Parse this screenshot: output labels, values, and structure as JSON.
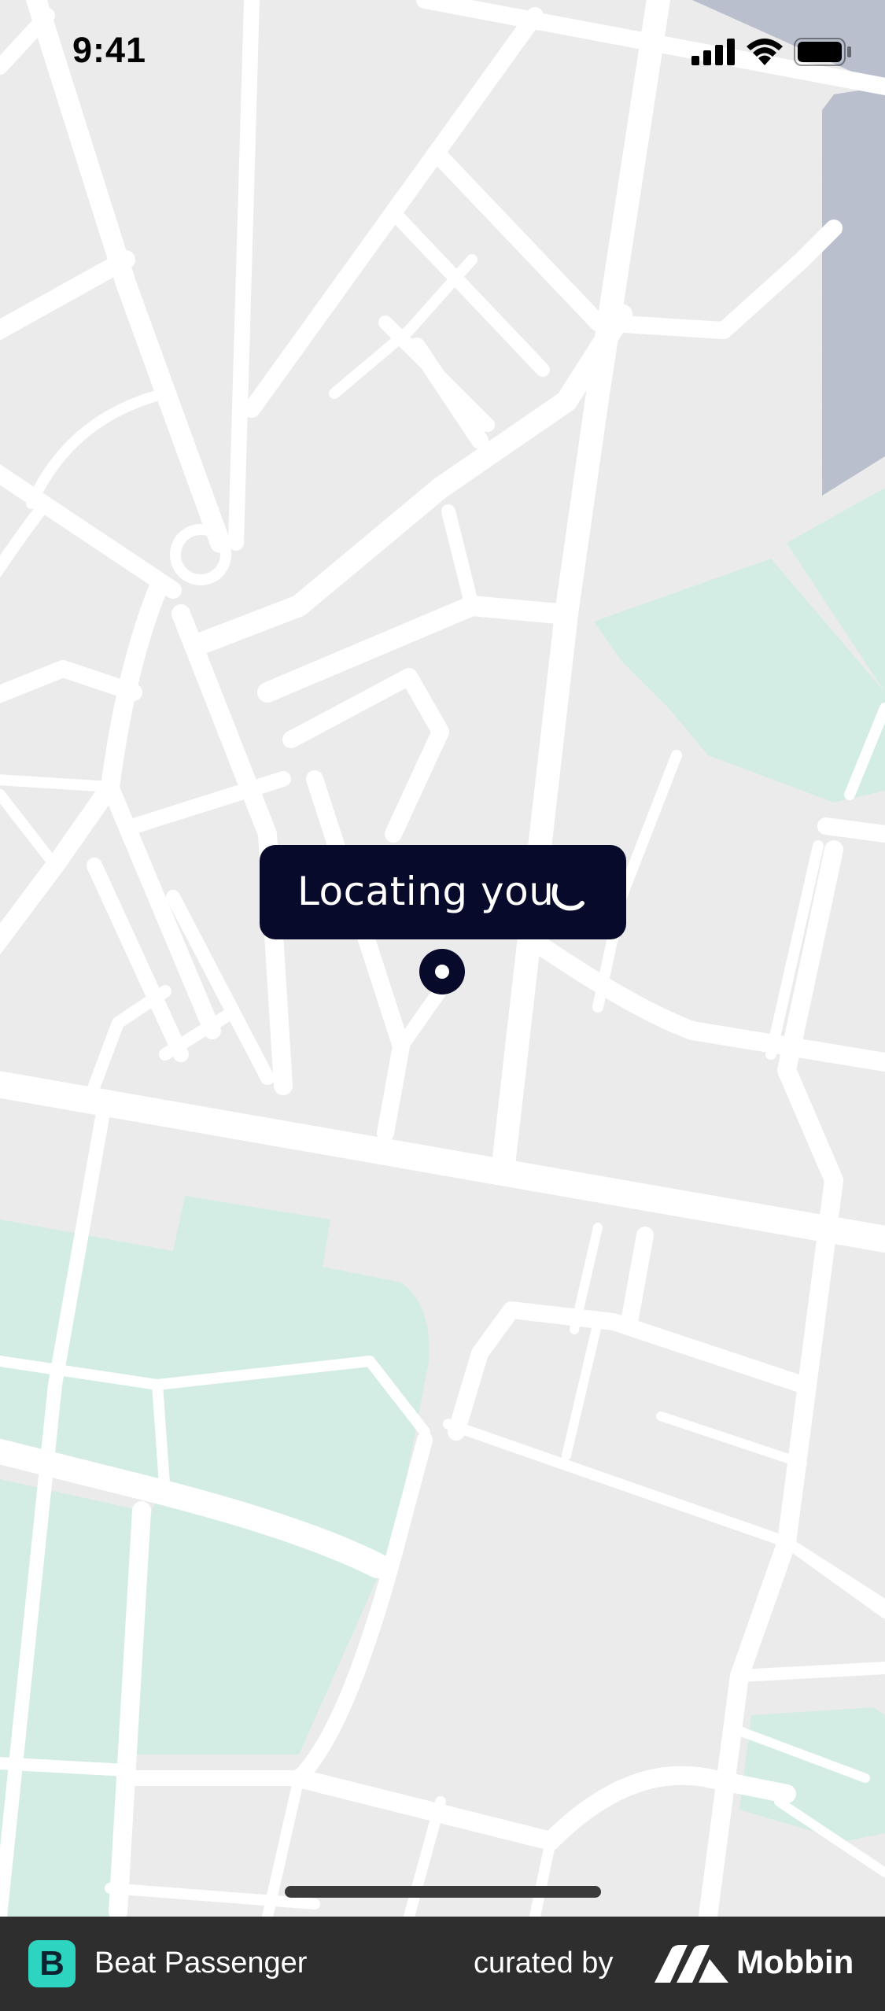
{
  "status_bar": {
    "time": "9:41",
    "icons": [
      "cellular-signal-icon",
      "wifi-icon",
      "battery-icon"
    ]
  },
  "map": {
    "colors": {
      "land": "#ebebeb",
      "road": "#ffffff",
      "park": "#d3ede4",
      "water": "#b9bfcc"
    }
  },
  "locating": {
    "label": "Locating you",
    "spinner_icon": "loading-spinner-icon",
    "background": "#070a2b"
  },
  "location_marker": {
    "icon": "current-location-icon"
  },
  "footer": {
    "app_logo_letter": "B",
    "app_name": "Beat Passenger",
    "curated_label": "curated by",
    "brand": "Mobbin",
    "logo_color": "#2dd4bf"
  }
}
